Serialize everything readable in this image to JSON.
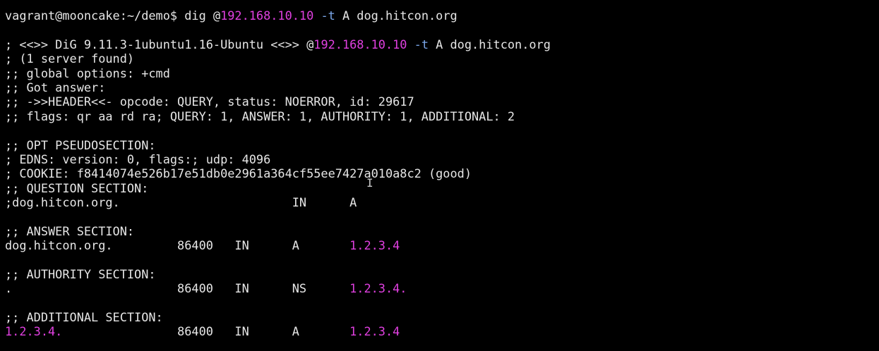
{
  "colors": {
    "background": "#000000",
    "text": "#e6e6e6",
    "ip_highlight": "#e040e0",
    "flag_highlight": "#7aa6e8"
  },
  "command": {
    "prompt": "vagrant@mooncake:~/demo$ dig @",
    "server": "192.168.10.10",
    "flag": "-t",
    "rest": " A dog.hitcon.org"
  },
  "banner": {
    "prefix": "; <<>> DiG 9.11.3-1ubuntu1.16-Ubuntu <<>> @",
    "server": "192.168.10.10",
    "flag": "-t",
    "rest": " A dog.hitcon.org"
  },
  "header_lines": [
    "; (1 server found)",
    ";; global options: +cmd",
    ";; Got answer:",
    ";; ->>HEADER<<- opcode: QUERY, status: NOERROR, id: 29617",
    ";; flags: qr aa rd ra; QUERY: 1, ANSWER: 1, AUTHORITY: 1, ADDITIONAL: 2"
  ],
  "opt_lines": [
    ";; OPT PSEUDOSECTION:",
    "; EDNS: version: 0, flags:; udp: 4096",
    "; COOKIE: f8414074e526b17e51db0e2961a364cf55ee7427a010a8c2 (good)",
    ";; QUESTION SECTION:",
    ";dog.hitcon.org.                        IN      A"
  ],
  "answer": {
    "heading": ";; ANSWER SECTION:",
    "record": "dog.hitcon.org.         86400   IN      A       ",
    "value": "1.2.3.4"
  },
  "authority": {
    "heading": ";; AUTHORITY SECTION:",
    "record": ".                       86400   IN      NS      ",
    "value": "1.2.3.4."
  },
  "additional": {
    "heading": ";; ADDITIONAL SECTION:",
    "name": "1.2.3.4.",
    "record": "                86400   IN      A       ",
    "value": "1.2.3.4"
  },
  "cursor_glyph": "I"
}
